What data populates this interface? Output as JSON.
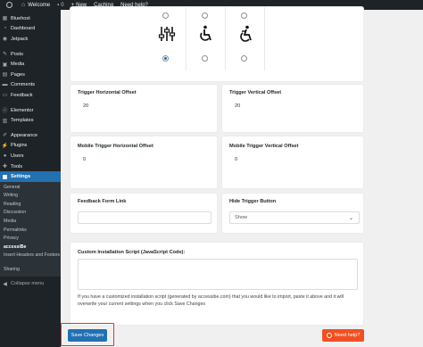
{
  "adminbar": {
    "site_name": "Welcome",
    "comments_count": "0",
    "new_label": "New",
    "caching_label": "Caching",
    "help_label": "Need help?"
  },
  "sidebar": {
    "items": [
      {
        "label": "Bluehost",
        "icon": "bluehost-icon"
      },
      {
        "label": "Dashboard",
        "icon": "dashboard-icon"
      },
      {
        "label": "Jetpack",
        "icon": "jetpack-icon"
      },
      {
        "label": "Posts",
        "icon": "pin-icon"
      },
      {
        "label": "Media",
        "icon": "media-icon"
      },
      {
        "label": "Pages",
        "icon": "pages-icon"
      },
      {
        "label": "Comments",
        "icon": "comments-icon"
      },
      {
        "label": "Feedback",
        "icon": "feedback-icon"
      },
      {
        "label": "Elementor",
        "icon": "elementor-icon"
      },
      {
        "label": "Templates",
        "icon": "templates-icon"
      },
      {
        "label": "Appearance",
        "icon": "brush-icon"
      },
      {
        "label": "Plugins",
        "icon": "plugin-icon"
      },
      {
        "label": "Users",
        "icon": "users-icon"
      },
      {
        "label": "Tools",
        "icon": "wrench-icon"
      },
      {
        "label": "Settings",
        "icon": "settings-icon"
      }
    ],
    "submenu": [
      {
        "label": "General"
      },
      {
        "label": "Writing"
      },
      {
        "label": "Reading"
      },
      {
        "label": "Discussion"
      },
      {
        "label": "Media"
      },
      {
        "label": "Permalinks"
      },
      {
        "label": "Privacy"
      },
      {
        "label": "accessiBe"
      },
      {
        "label": "Insert Headers and Footers"
      },
      {
        "label": "Sharing"
      }
    ],
    "collapse_label": "Collapse menu"
  },
  "form": {
    "trigger_horizontal_offset": {
      "label": "Trigger Horizontal Offset",
      "value": "20"
    },
    "trigger_vertical_offset": {
      "label": "Trigger Vertical Offset",
      "value": "20"
    },
    "mobile_trigger_horizontal_offset": {
      "label": "Mobile Trigger Horizontal Offset",
      "value": "0"
    },
    "mobile_trigger_vertical_offset": {
      "label": "Mobile Trigger Vertical Offset",
      "value": "0"
    },
    "feedback_form_link": {
      "label": "Feedback Form Link",
      "value": ""
    },
    "hide_trigger_button": {
      "label": "Hide Trigger Button",
      "value": "Show"
    },
    "custom_script": {
      "label": "Custom Installation Script (JavaScript Code):",
      "help": "If you have a customized installation script (generated by accessibe.com) that you would like to import, paste it above and it will overwrite your current settings when you click Save Changes"
    },
    "save_label": "Save Changes",
    "need_help_label": "Need help?"
  }
}
